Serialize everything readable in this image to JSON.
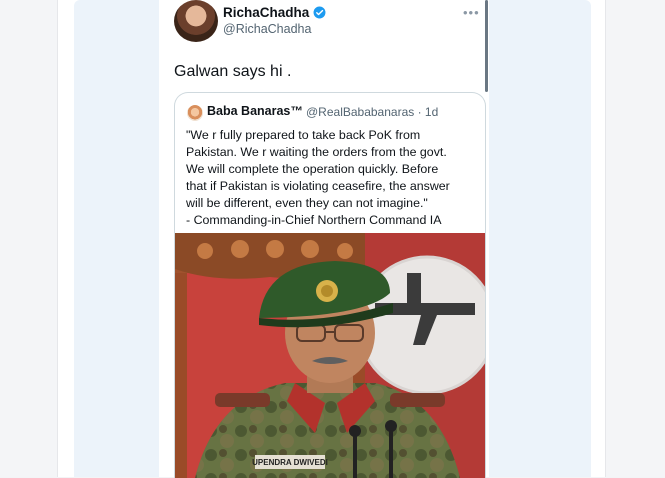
{
  "tweet": {
    "display_name": "RichaChadha",
    "handle": "@RichaChadha",
    "more": "•••",
    "text": "Galwan says hi ."
  },
  "quoted": {
    "display_name": "Baba Banaras™",
    "handle_meta": "@RealBababanaras · 1d",
    "lines": [
      "\"We r fully prepared to take back PoK from",
      "Pakistan. We r waiting the orders from the govt.",
      "We will complete the operation quickly. Before",
      "that if Pakistan is violating ceasefire, the answer",
      "will be different, even they can not imagine.\"",
      "- Commanding-in-Chief Northern Command IA"
    ],
    "name_tag": "UPENDRA DWIVEDI"
  },
  "colors": {
    "verified": "#1d9bf0",
    "background": "#f3f4f6",
    "quote_border": "#cfd9de"
  }
}
